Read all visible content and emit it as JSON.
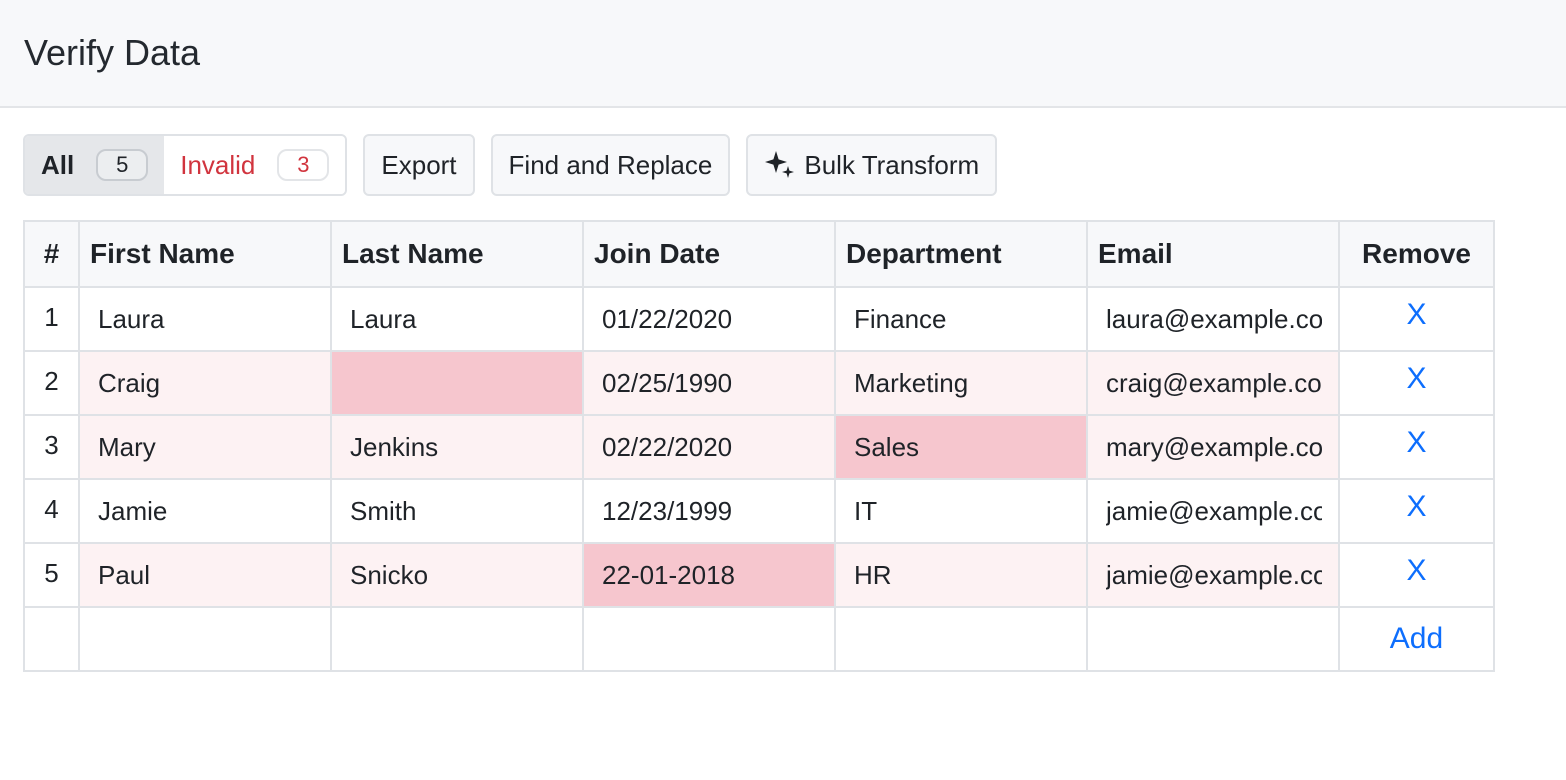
{
  "header": {
    "title": "Verify Data"
  },
  "filter": {
    "all_label": "All",
    "all_count": "5",
    "invalid_label": "Invalid",
    "invalid_count": "3"
  },
  "toolbar": {
    "export_label": "Export",
    "find_replace_label": "Find and Replace",
    "bulk_transform_label": "Bulk Transform",
    "bulk_transform_icon": "sparkle-icon"
  },
  "table": {
    "headers": {
      "num": "#",
      "first": "First Name",
      "last": "Last Name",
      "join": "Join Date",
      "dept": "Department",
      "email": "Email",
      "remove": "Remove"
    },
    "remove_label": "X",
    "add_label": "Add",
    "rows": [
      {
        "num": "1",
        "first": "Laura",
        "last": "Laura",
        "join": "01/22/2020",
        "dept": "Finance",
        "email": "laura@example.com"
      },
      {
        "num": "2",
        "first": "Craig",
        "last": "",
        "join": "02/25/1990",
        "dept": "Marketing",
        "email": "craig@example.com"
      },
      {
        "num": "3",
        "first": "Mary",
        "last": "Jenkins",
        "join": "02/22/2020",
        "dept": "Sales",
        "email": "mary@example.com"
      },
      {
        "num": "4",
        "first": "Jamie",
        "last": "Smith",
        "join": "12/23/1999",
        "dept": "IT",
        "email": "jamie@example.com"
      },
      {
        "num": "5",
        "first": "Paul",
        "last": "Snicko",
        "join": "22-01-2018",
        "dept": "HR",
        "email": "jamie@example.com"
      }
    ]
  },
  "colors": {
    "invalid_text": "#d1343e",
    "invalid_row_bg": "#fdf2f3",
    "invalid_cell_bg": "#f6c6ce",
    "link": "#0d6efd"
  }
}
